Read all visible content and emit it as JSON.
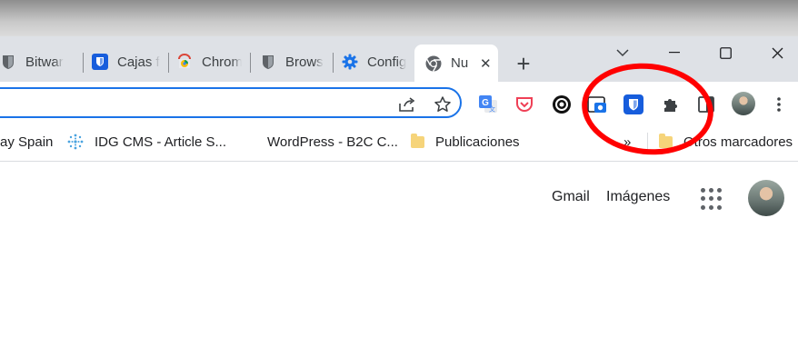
{
  "colors": {
    "accent": "#1a73e8",
    "annotation": "#ff0000",
    "tabstrip": "#dee1e6"
  },
  "tabs": [
    {
      "label": "Bitwar",
      "icon": "shield-icon",
      "active": false
    },
    {
      "label": "Cajas f",
      "icon": "bitwarden-icon",
      "active": false
    },
    {
      "label": "Chrom",
      "icon": "chrome-web-store-icon",
      "active": false
    },
    {
      "label": "Brows",
      "icon": "shield-icon",
      "active": false
    },
    {
      "label": "Config",
      "icon": "gear-icon",
      "active": false
    },
    {
      "label": "Nu",
      "icon": "chrome-icon",
      "active": true
    }
  ],
  "tabstrip": {
    "new_tab_symbol": "+"
  },
  "window_controls": {
    "minimize": "—",
    "maximize": "☐",
    "close": "✕",
    "tab_search": "⌄"
  },
  "extensions": [
    "google-translate-icon",
    "pocket-icon",
    "camera-lens-icon",
    "screenshot-icon",
    "bitwarden-icon",
    "puzzle-icon",
    "sidebar-icon",
    "profile-avatar",
    "menu-icon"
  ],
  "bookmarks": [
    {
      "label": "ay Spain"
    },
    {
      "label": "IDG CMS - Article S..."
    },
    {
      "label": "WordPress - B2C C..."
    },
    {
      "label": "Publicaciones"
    },
    {
      "label": "»"
    },
    {
      "label": "Otros marcadores"
    }
  ],
  "google_links": {
    "gmail": "Gmail",
    "images": "Imágenes"
  }
}
